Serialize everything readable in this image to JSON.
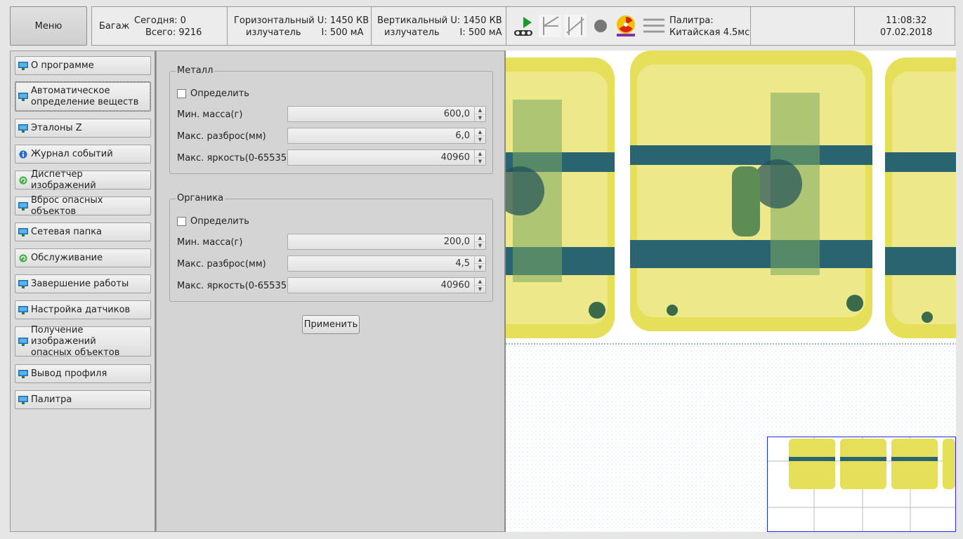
{
  "menu": {
    "label": "Меню"
  },
  "status": {
    "baggage_label": "Багаж",
    "today": "Сегодня: 0",
    "total": "Всего: 9216",
    "horizontal_line1": "Горизонтальный U: 1450 КВ",
    "horizontal_line2": "излучатель       I: 500 мА",
    "vertical_line1": "Вертикальный U: 1450 КВ",
    "vertical_line2": "излучатель       I: 500 мА",
    "palette_line1": "Палитра:",
    "palette_line2": "Китайская 4.5мс",
    "time": "11:08:32",
    "date": "07.02.2018"
  },
  "toolbar_icons": [
    "conveyor-play-icon",
    "edge-filter-icon",
    "slope-filter-icon",
    "record-dot-icon",
    "radiation-icon",
    "lines-icon"
  ],
  "sidebar": {
    "items": [
      {
        "label": "О программе",
        "icon": "monitor"
      },
      {
        "label": "Автоматическое\nопределение веществ",
        "icon": "monitor",
        "active": true
      },
      {
        "label": "Эталоны Z",
        "icon": "monitor"
      },
      {
        "label": "Журнал событий",
        "icon": "info"
      },
      {
        "label": "Диспетчер изображений",
        "icon": "refresh"
      },
      {
        "label": "Вброс опасных объектов",
        "icon": "monitor"
      },
      {
        "label": "Сетевая папка",
        "icon": "monitor"
      },
      {
        "label": "Обслуживание",
        "icon": "refresh"
      },
      {
        "label": "Завершение работы",
        "icon": "monitor"
      },
      {
        "label": "Настройка датчиков",
        "icon": "monitor"
      },
      {
        "label": "Получение изображений\nопасных объектов",
        "icon": "monitor"
      },
      {
        "label": "Вывод профиля",
        "icon": "monitor"
      },
      {
        "label": "Палитра",
        "icon": "monitor"
      }
    ]
  },
  "metal": {
    "title": "Металл",
    "detect_label": "Определить",
    "min_mass_label": "Мин. масса(г)",
    "min_mass_value": "600,0",
    "max_spread_label": "Макс. разброс(мм)",
    "max_spread_value": "6,0",
    "max_brightness_label": "Макс. яркость(0-65535)",
    "max_brightness_value": "40960"
  },
  "organic": {
    "title": "Органика",
    "detect_label": "Определить",
    "min_mass_label": "Мин. масса(г)",
    "min_mass_value": "200,0",
    "max_spread_label": "Макс. разброс(мм)",
    "max_spread_value": "4,5",
    "max_brightness_label": "Макс. яркость(0-65535)",
    "max_brightness_value": "40960"
  },
  "apply_label": "Применить",
  "colors": {
    "xray_yellow": "#e8e24a",
    "xray_green": "#6aa84f",
    "xray_teal": "#1f5f6b",
    "minimap_border": "#1e2ee0"
  }
}
